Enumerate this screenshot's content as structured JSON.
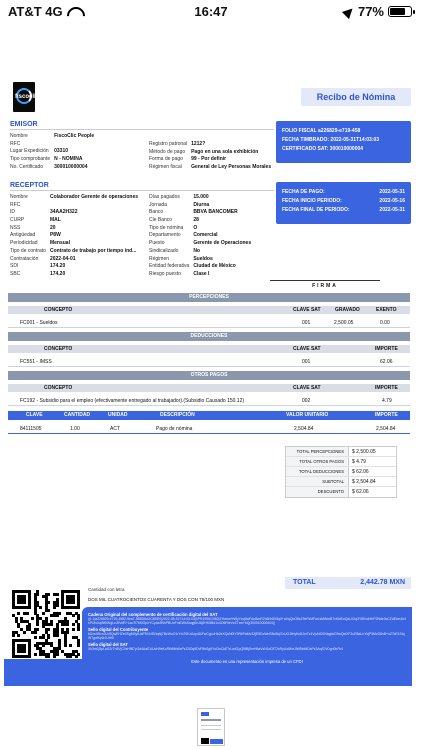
{
  "status_bar": {
    "carrier": "AT&T 4G",
    "time": "16:47",
    "battery": "77%",
    "battery_level": 0.77
  },
  "document": {
    "title": "Recibo de Nómina",
    "logo_text": "fiscoclic",
    "emisor": {
      "heading": "EMISOR",
      "left": [
        {
          "k": "Nombre",
          "v": "FiscoClic People"
        },
        {
          "k": "RFC",
          "v": ""
        },
        {
          "k": "Lugar Expedición",
          "v": "03310"
        },
        {
          "k": "Tipo comprobante",
          "v": "N - NÓMINA"
        },
        {
          "k": "No. Certificado",
          "v": "300010000004"
        }
      ],
      "right": [
        {
          "k": "Registro patronal",
          "v": "1212?"
        },
        {
          "k": "Método de pago",
          "v": "Pago en una sola exhibición"
        },
        {
          "k": "Forma de pago",
          "v": "99 - Por definir"
        },
        {
          "k": "Régimen fiscal",
          "v": "General de Ley Personas Morales"
        }
      ],
      "box": [
        {
          "lab": "FOLIO FISCAL a226829-e719-458",
          "val": ""
        },
        {
          "lab": "FECHA TIMBRADO: 2022-05-31T14:03:03",
          "val": ""
        },
        {
          "lab": "CERTIFICADO SAT: 300010000004",
          "val": ""
        }
      ]
    },
    "receptor": {
      "heading": "RECEPTOR",
      "left": [
        {
          "k": "Nombre",
          "v": "Colaborador Gerente de operaciones"
        },
        {
          "k": "RFC",
          "v": ""
        },
        {
          "k": "ID",
          "v": "34AA2H322"
        },
        {
          "k": "CURP",
          "v": "MAL"
        },
        {
          "k": "NSS",
          "v": "20"
        },
        {
          "k": "Antigüedad",
          "v": "P8W"
        },
        {
          "k": "Periodicidad",
          "v": "Mensual"
        },
        {
          "k": "Tipo de contrato",
          "v": "Contrato de trabajo por tiempo ind..."
        },
        {
          "k": "Contratación",
          "v": "2022-04-01"
        },
        {
          "k": "SDI",
          "v": "174.20"
        },
        {
          "k": "SBC",
          "v": "174.20"
        }
      ],
      "right": [
        {
          "k": "Días pagados",
          "v": "15.000"
        },
        {
          "k": "Jornada",
          "v": "Diurna"
        },
        {
          "k": "Banco",
          "v": "BBVA BANCOMER"
        },
        {
          "k": "Cle Banco",
          "v": "28"
        },
        {
          "k": "Tipo de nómina",
          "v": "O"
        },
        {
          "k": "Departamento",
          "v": "Comercial"
        },
        {
          "k": "Puesto",
          "v": "Gerente de Operaciones"
        },
        {
          "k": "Sindicalizado",
          "v": "No"
        },
        {
          "k": "Régimen",
          "v": "Sueldos"
        },
        {
          "k": "Entidad federativa",
          "v": "Ciudad de México"
        },
        {
          "k": "Riesgo puesto",
          "v": "Clase I"
        }
      ],
      "box": [
        {
          "lab": "FECHA DE PAGO:",
          "val": "2022-05-31"
        },
        {
          "lab": "FECHA INICIO PERIODO:",
          "val": "2022-05-16"
        },
        {
          "lab": "FECHA FINAL DE PERIODO:",
          "val": "2022-05-31"
        }
      ]
    },
    "firma": "FIRMA",
    "percepciones": {
      "title": "PERCEPCIONES",
      "headers": [
        "CONCEPTO",
        "CLAVE SAT",
        "GRAVADO",
        "EXENTO"
      ],
      "rows": [
        [
          "FC001 - Sueldos",
          "001",
          "2,500.05",
          "0.00"
        ]
      ]
    },
    "deducciones": {
      "title": "DEDUCCIONES",
      "headers": [
        "CONCEPTO",
        "CLAVE SAT",
        "IMPORTE"
      ],
      "rows": [
        [
          "FC551 - IMSS",
          "001",
          "62.06"
        ]
      ]
    },
    "otros_pagos": {
      "title": "OTROS PAGOS",
      "headers": [
        "CONCEPTO",
        "CLAVE SAT",
        "IMPORTE"
      ],
      "rows": [
        [
          "FC192 - Subsidio para el empleo (efectivamente entregado al trabajador).(Subsidio Causado 150.12)",
          "002",
          "4.79"
        ]
      ]
    },
    "conceptos": {
      "headers": [
        "CLAVE",
        "CANTIDAD",
        "UNIDAD",
        "DESCRIPCIÓN",
        "VALOR UNITARIO",
        "IMPORTE"
      ],
      "row": [
        "84111505",
        "1.00",
        "ACT",
        "Pago de nómina",
        "2,504.84",
        "2,504.84"
      ]
    },
    "totals": [
      {
        "lab": "TOTAL PERCEPCIONES",
        "val": "$ 2,500.05"
      },
      {
        "lab": "TOTAL OTROS PAGOS",
        "val": "$ 4.79"
      },
      {
        "lab": "TOTAL DEDUCCIONES",
        "val": "$ 62.06"
      },
      {
        "lab": "SUBTOTAL",
        "val": "$ 2,504.84"
      },
      {
        "lab": "DESCUENTO",
        "val": "$ 62.06"
      }
    ],
    "total": {
      "lab": "TOTAL",
      "val": "2,442.78 MXN"
    },
    "cantidad_letra_label": "Cantidad con letra",
    "cantidad_letra": "DOS MIL CUATROCIENTOS CUARENTA Y DOS CON 78/100 MXN",
    "seal": {
      "cadena_h": "Cadena Original del complemento de certificación digital del SAT",
      "cadena_t": "||1.1|a226829-e719-4582-9ba7-5B8D6A2CB5D0|2022-05-31T14:03:03|SPR190613I52|JYbmw+fs9yYcvjIlwFAnBmR2h6Hr8X5q0+aVqQnO8sZ9eFsMFwLsMWmB7vt0dSoQaL0Xq3Y5KwbHrP2Nde3cCZdEsm1k4sPUtvXqBf0iWgLzJ9VdR+LcuTi7M0Gp/rYCyAs9NhPBUnFmEWkSxqg0hJ8j2HK5Bd1o4O6RIeVzZTxw+bQ|300010000004||",
      "sello_c_h": "Sello digital del Contribuyente",
      "sello_c_t": "bDxs4Rvn2Lk9QwEHZe0SgM3yfUaP5XhI8VtqNj7BcWoO1rYmT6KdJzp4AiFwCgLuHb2eXQsN0tY9RkPaMv3ZjE5DcWnS8oBqI7xUG1fHyKr6lJmTz4VpAtO0NbgdsC9wQeiXF2uR5aLhYkjP3MvD8nB+oZTcE1SIqW7gxfKy6rJUHl0",
      "sello_s_h": "Sello digital del SAT",
      "sello_s_t": "Xk3mQ8pLw2ZrTn5VjC0sHfB7yGd4AaE1iUoN9eKcR6tMbWxPzJ2lOq5DvF8hSg0YuI3nCkE7rLw4ZpQ9tBjXmH6aVsN1dGfT2cRyUo8KeJiW5bMlOxPz3AqS7vDgn0hFk4",
      "footer": "Este documento es una representación impresa de un CFDI"
    }
  }
}
